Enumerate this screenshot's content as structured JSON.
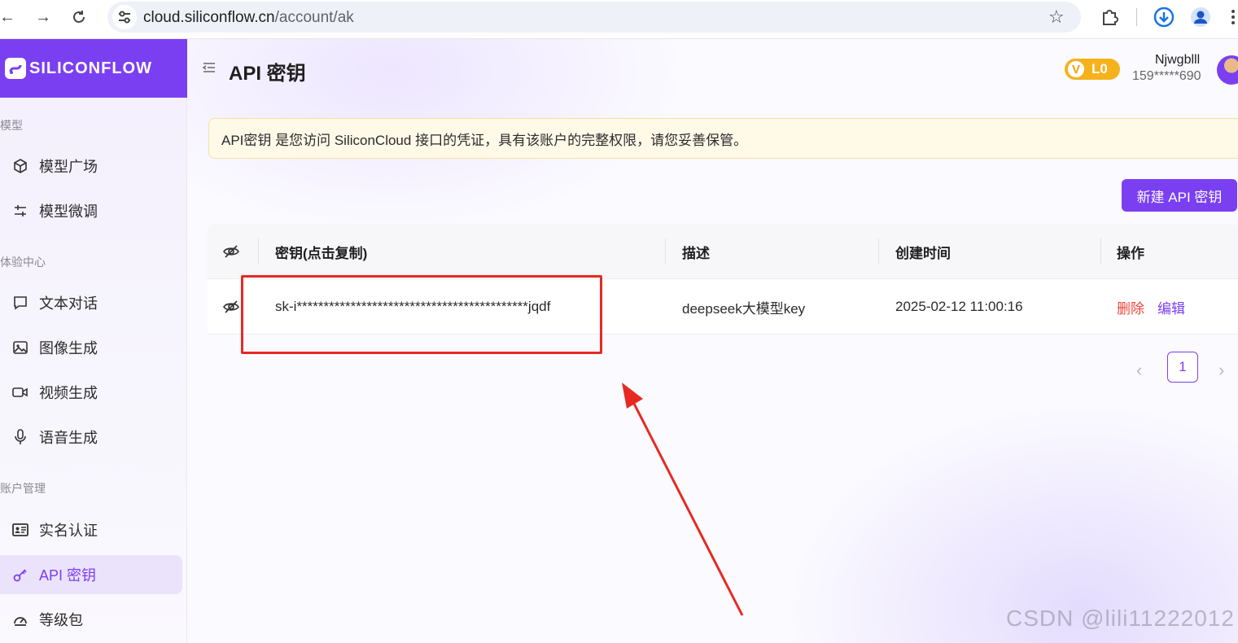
{
  "browser": {
    "url_host": "cloud.siliconflow.cn",
    "url_path": "/account/ak"
  },
  "brand": {
    "name": "SILICONFLOW"
  },
  "sidebar": {
    "sections": [
      {
        "title": "模型",
        "items": [
          {
            "label": "模型广场",
            "icon": "cube-icon"
          },
          {
            "label": "模型微调",
            "icon": "sliders-icon"
          }
        ]
      },
      {
        "title": "体验中心",
        "items": [
          {
            "label": "文本对话",
            "icon": "chat-icon"
          },
          {
            "label": "图像生成",
            "icon": "image-icon"
          },
          {
            "label": "视频生成",
            "icon": "video-icon"
          },
          {
            "label": "语音生成",
            "icon": "microphone-icon"
          }
        ]
      },
      {
        "title": "账户管理",
        "items": [
          {
            "label": "实名认证",
            "icon": "id-card-icon"
          },
          {
            "label": "API 密钥",
            "icon": "key-icon",
            "active": true
          },
          {
            "label": "等级包",
            "icon": "gauge-icon"
          }
        ]
      }
    ]
  },
  "header": {
    "title": "API 密钥",
    "vip_letter": "V",
    "vip_level": "L0",
    "user_name": "Njwgblll",
    "user_phone": "159*****690"
  },
  "notice": {
    "text": "API密钥 是您访问 SiliconCloud 接口的凭证，具有该账户的完整权限，请您妥善保管。"
  },
  "actions": {
    "new_key": "新建 API 密钥"
  },
  "table": {
    "columns": [
      "密钥(点击复制)",
      "描述",
      "创建时间",
      "操作"
    ],
    "rows": [
      {
        "key": "sk-i*******************************************jqdf",
        "description": "deepseek大模型key",
        "created": "2025-02-12 11:00:16",
        "delete_label": "删除",
        "edit_label": "编辑"
      }
    ]
  },
  "pagination": {
    "current": "1"
  },
  "colors": {
    "accent": "#7b3ff2",
    "danger": "#f0453a",
    "annotation": "#e62a23",
    "vip": "#f5b21b"
  },
  "watermark": "CSDN @lili11222012"
}
